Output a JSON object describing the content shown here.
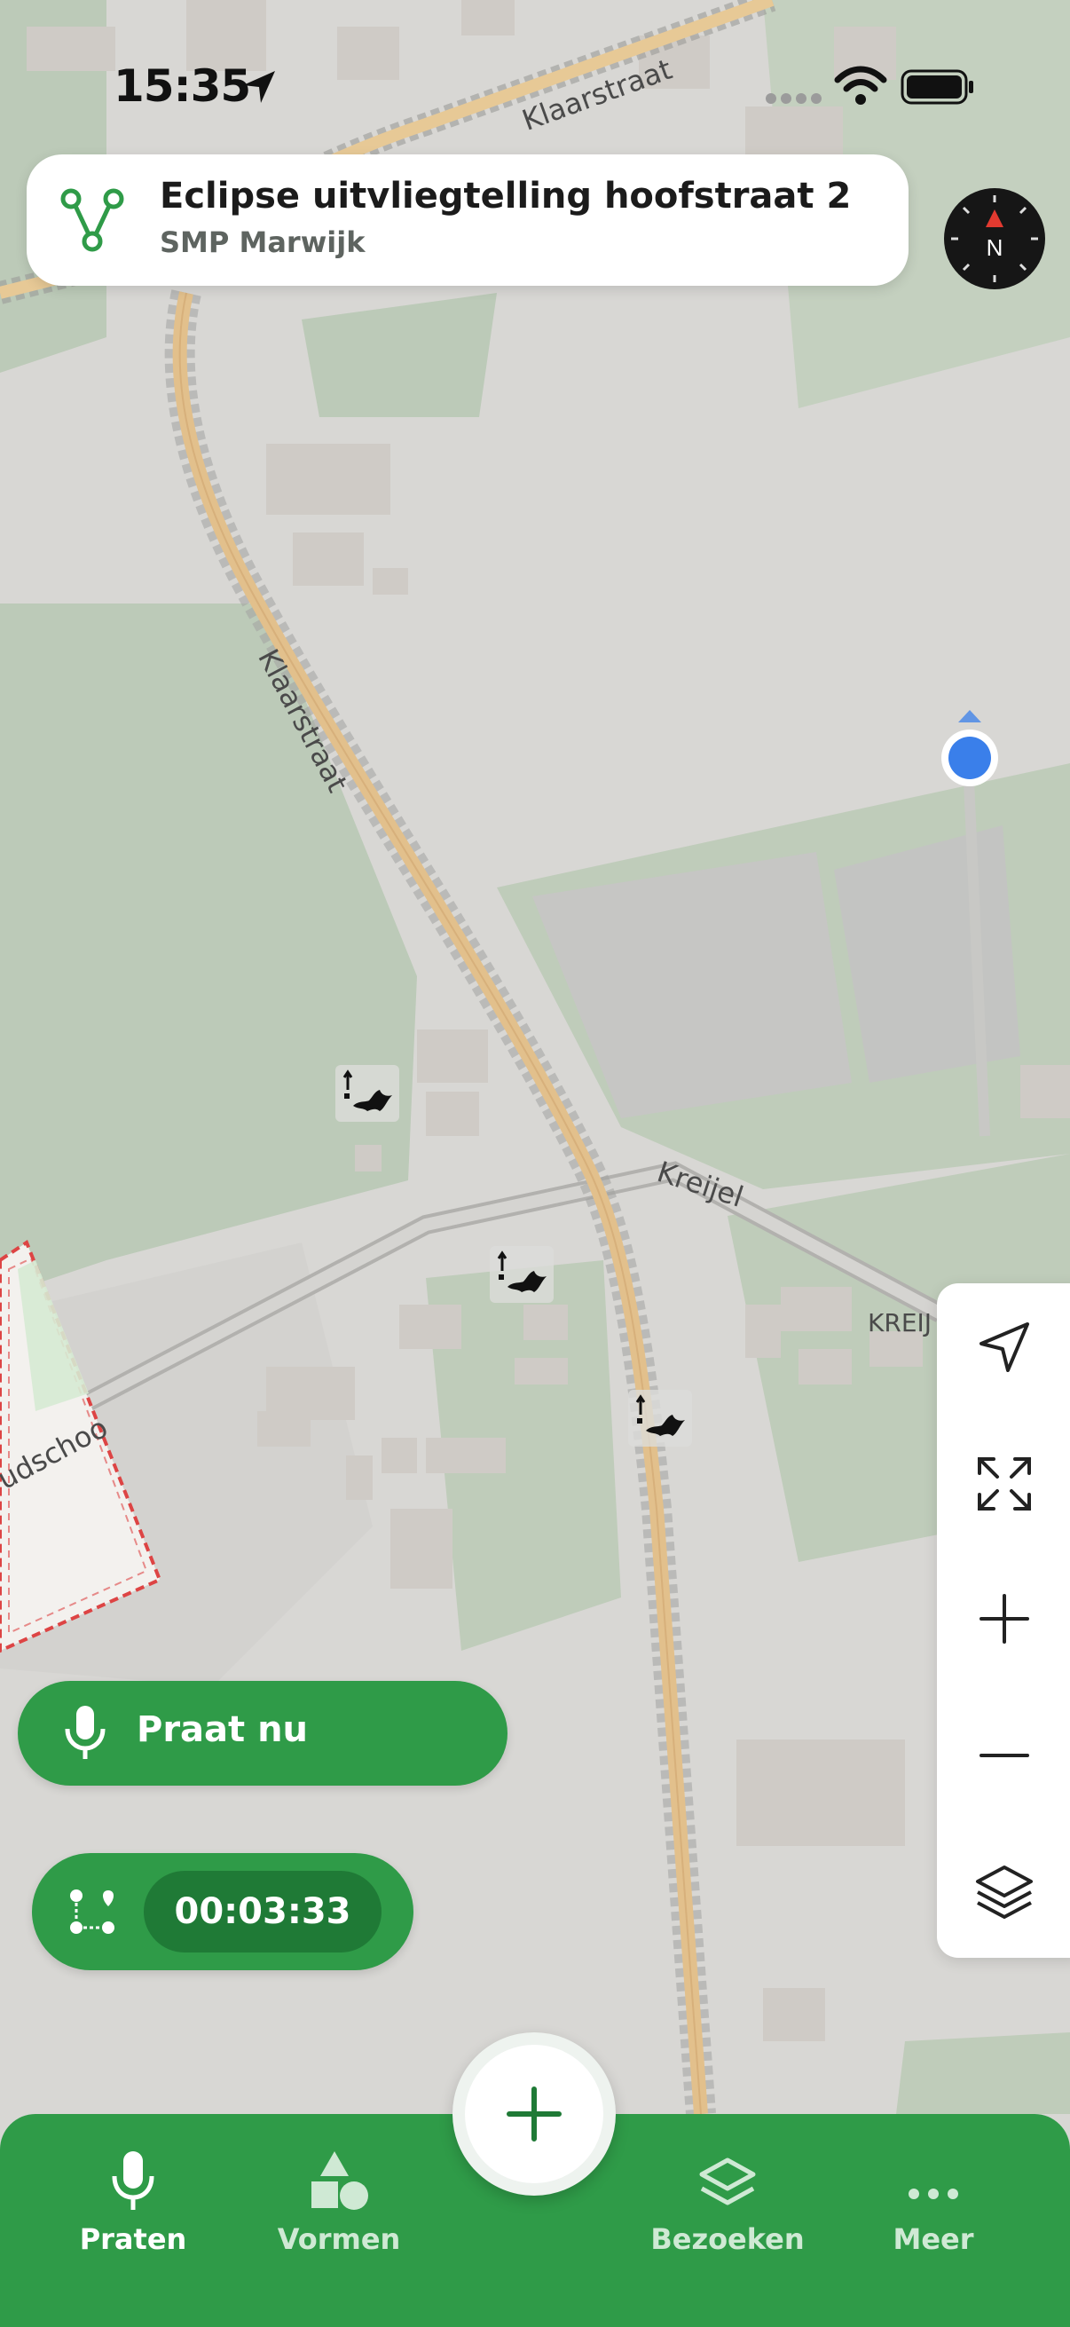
{
  "status_bar": {
    "time": "15:35"
  },
  "header": {
    "title": "Eclipse uitvliegtelling hoofstraat 2",
    "subtitle": "SMP Marwijk"
  },
  "compass": {
    "label": "N"
  },
  "map": {
    "street_labels": {
      "klaarstraat_top": "Klaarstraat",
      "klaarstraat": "Klaarstraat",
      "kreijel": "Kreijel",
      "kreijel_caps": "KREIJ",
      "fragment": "udschoo"
    },
    "bat_marker_count": 3
  },
  "talk_button": {
    "label": "Praat nu"
  },
  "timer": {
    "value": "00:03:33"
  },
  "bottom_nav": {
    "items": [
      {
        "label": "Praten"
      },
      {
        "label": "Vormen"
      },
      {
        "label": "Bezoeken"
      },
      {
        "label": "Meer"
      }
    ]
  },
  "colors": {
    "accent": "#2f9b48",
    "accent_dark": "#1f7a36",
    "location_blue": "#3a7fea",
    "compass_red": "#e23a30"
  }
}
